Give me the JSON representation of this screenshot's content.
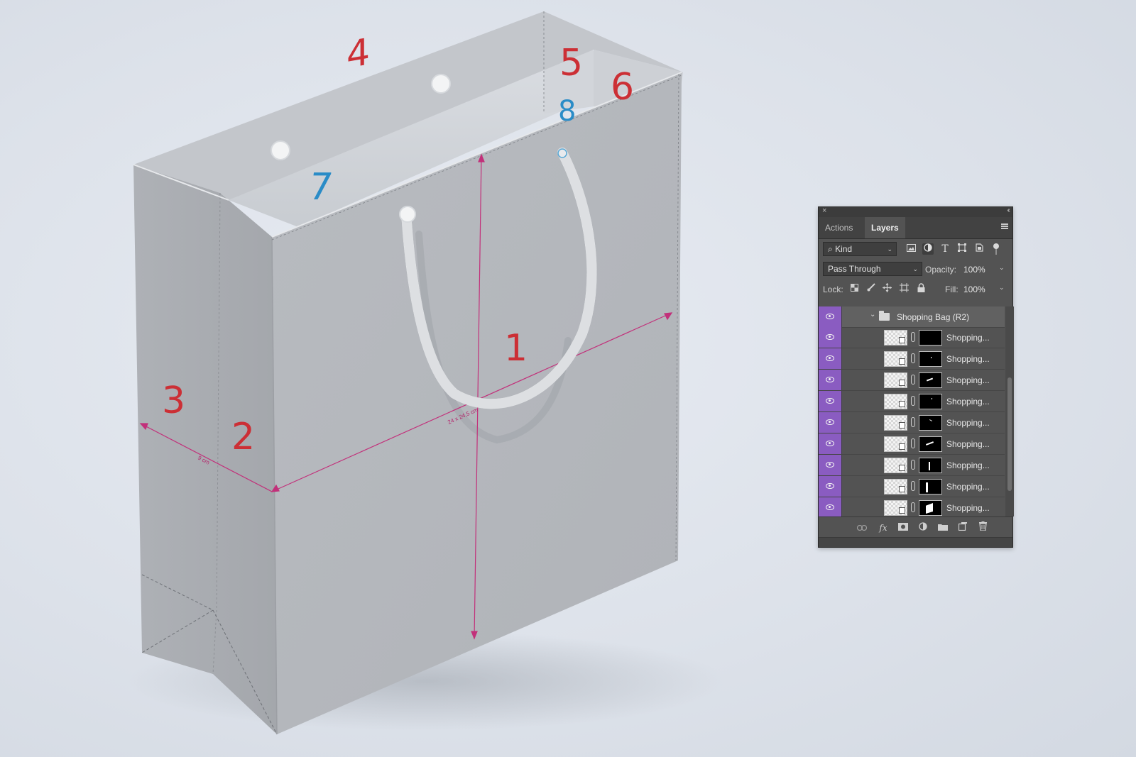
{
  "bag": {
    "panel_numbers": [
      "1",
      "2",
      "3",
      "4",
      "5",
      "6",
      "7",
      "8"
    ],
    "dimension_front": "24 x 24,5 cm",
    "dimension_side": "9 cm"
  },
  "layers_panel": {
    "close_glyph": "×",
    "collapse_glyph": "‹‹",
    "tabs": [
      {
        "label": "Actions",
        "active": false
      },
      {
        "label": "Layers",
        "active": true
      }
    ],
    "filter": {
      "kind_label": "Kind",
      "search_glyph": "⌕"
    },
    "blend": {
      "mode": "Pass Through",
      "opacity_label": "Opacity:",
      "opacity_value": "100%"
    },
    "lock": {
      "label": "Lock:",
      "fill_label": "Fill:",
      "fill_value": "100%"
    },
    "group": {
      "name": "Shopping Bag (R2)",
      "expanded": true
    },
    "layers": [
      {
        "name": "Shopping..."
      },
      {
        "name": "Shopping..."
      },
      {
        "name": "Shopping..."
      },
      {
        "name": "Shopping..."
      },
      {
        "name": "Shopping..."
      },
      {
        "name": "Shopping..."
      },
      {
        "name": "Shopping..."
      },
      {
        "name": "Shopping..."
      },
      {
        "name": "Shopping..."
      }
    ],
    "footer_icons": [
      "link-icon",
      "fx-icon",
      "mask-icon",
      "adjustment-icon",
      "folder-icon",
      "new-layer-icon",
      "trash-icon"
    ],
    "fx_label": "fx",
    "accent_color": "#8a5cc1"
  }
}
